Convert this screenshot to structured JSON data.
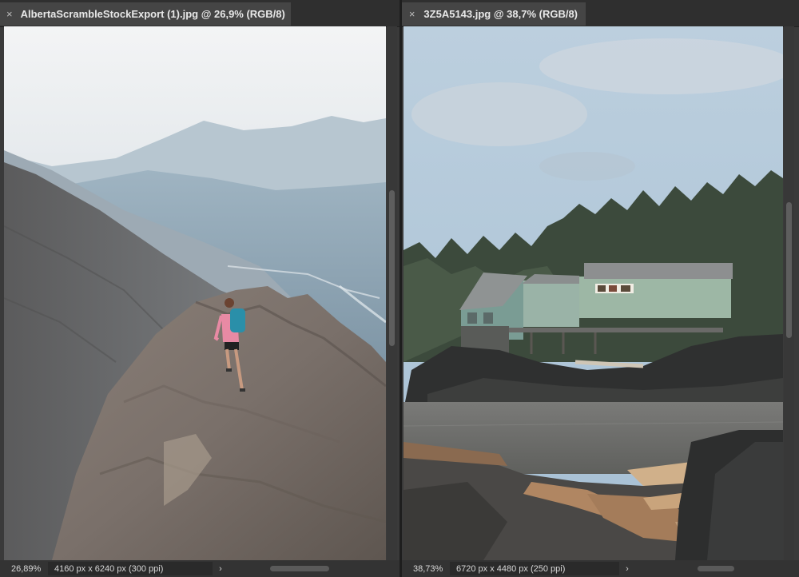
{
  "left_document": {
    "tab_title": "AlbertaScrambleStockExport (1).jpg @ 26,9% (RGB/8)",
    "close_icon": "×",
    "zoom": "26,89%",
    "doc_size": "4160 px x 6240 px (300 ppi)",
    "menu_arrow": "›"
  },
  "right_document": {
    "tab_title": "3Z5A5143.jpg @ 38,7% (RGB/8)",
    "close_icon": "×",
    "zoom": "38,73%",
    "doc_size": "6720 px x 4480 px (250 ppi)",
    "menu_arrow": "›"
  }
}
